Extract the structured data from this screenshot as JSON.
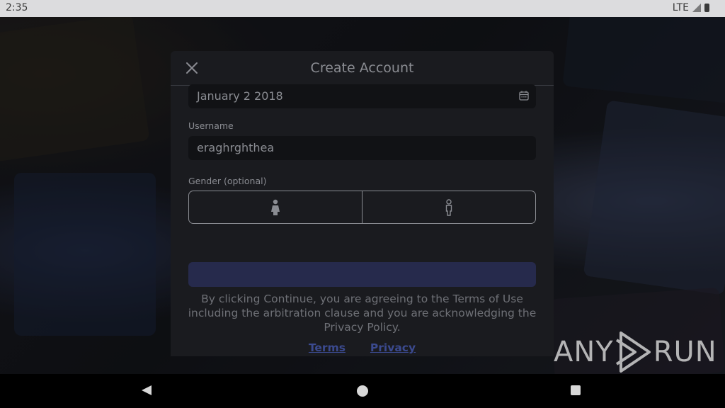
{
  "status_bar": {
    "time": "2:35",
    "network": "LTE"
  },
  "modal": {
    "title": "Create Account",
    "birthday": {
      "value": "January 2 2018"
    },
    "username": {
      "label": "Username",
      "value": "eraghrghthea"
    },
    "gender": {
      "label": "Gender (optional)",
      "options": [
        "female-icon",
        "male-icon"
      ]
    },
    "legal_text": "By clicking Continue, you are agreeing to the Terms of Use including the arbitration clause and you are acknowledging the Privacy Policy.",
    "links": {
      "terms": "Terms",
      "privacy": "Privacy"
    }
  },
  "watermark": {
    "text_left": "ANY",
    "text_right": "RUN"
  },
  "colors": {
    "accent": "#262a4c",
    "link": "#3b4a8f",
    "modal_bg": "#1a1b1f"
  }
}
